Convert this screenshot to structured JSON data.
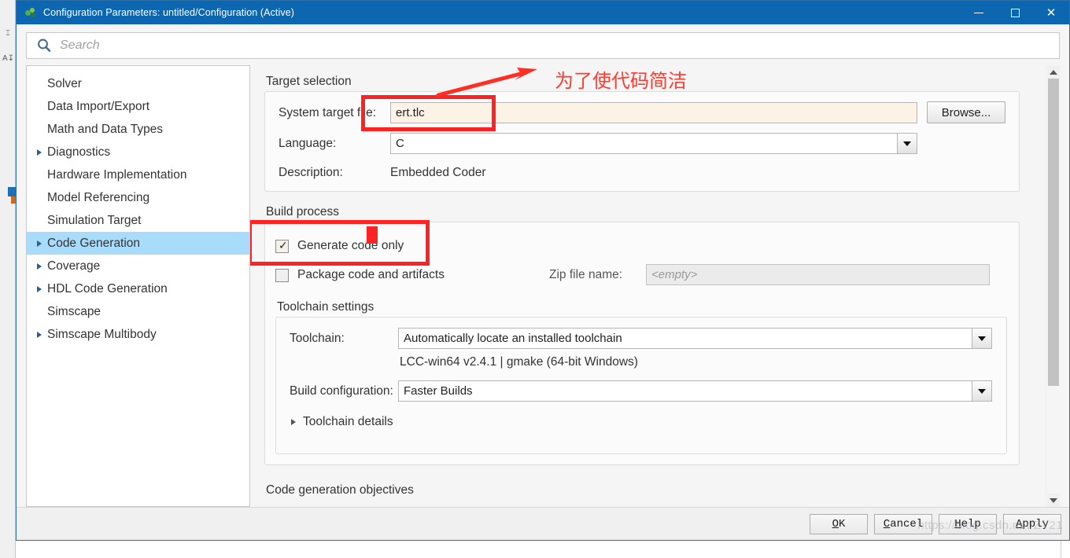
{
  "window": {
    "title": "Configuration Parameters: untitled/Configuration (Active)",
    "icon": "simulink-icon",
    "minimize_label": "—",
    "maximize_label": "□",
    "close_label": "✕"
  },
  "search": {
    "placeholder": "Search",
    "value": "",
    "icon": "search-icon"
  },
  "sidebar": {
    "items": [
      {
        "label": "Solver",
        "expandable": false,
        "selected": false
      },
      {
        "label": "Data Import/Export",
        "expandable": false,
        "selected": false
      },
      {
        "label": "Math and Data Types",
        "expandable": false,
        "selected": false
      },
      {
        "label": "Diagnostics",
        "expandable": true,
        "selected": false
      },
      {
        "label": "Hardware Implementation",
        "expandable": false,
        "selected": false
      },
      {
        "label": "Model Referencing",
        "expandable": false,
        "selected": false
      },
      {
        "label": "Simulation Target",
        "expandable": false,
        "selected": false
      },
      {
        "label": "Code Generation",
        "expandable": true,
        "selected": true
      },
      {
        "label": "Coverage",
        "expandable": true,
        "selected": false
      },
      {
        "label": "HDL Code Generation",
        "expandable": true,
        "selected": false
      },
      {
        "label": "Simscape",
        "expandable": false,
        "selected": false
      },
      {
        "label": "Simscape Multibody",
        "expandable": true,
        "selected": false
      }
    ]
  },
  "target_selection": {
    "title": "Target selection",
    "system_target_file_label": "System target file:",
    "system_target_file_value": "ert.tlc",
    "browse_label": "Browse...",
    "language_label": "Language:",
    "language_value": "C",
    "description_label": "Description:",
    "description_value": "Embedded Coder"
  },
  "build_process": {
    "title": "Build process",
    "generate_code_only_label": "Generate code only",
    "generate_code_only_checked": true,
    "package_code_label": "Package code and artifacts",
    "package_code_checked": false,
    "zip_file_name_label": "Zip file name:",
    "zip_file_name_placeholder": "<empty>",
    "zip_file_name_value": ""
  },
  "toolchain_settings": {
    "title": "Toolchain settings",
    "toolchain_label": "Toolchain:",
    "toolchain_value": "Automatically locate an installed toolchain",
    "toolchain_info": "LCC-win64 v2.4.1 | gmake (64-bit Windows)",
    "build_configuration_label": "Build configuration:",
    "build_configuration_value": "Faster Builds",
    "toolchain_details_label": "Toolchain details"
  },
  "code_generation_objectives": {
    "title": "Code generation objectives"
  },
  "buttons": {
    "ok": {
      "pre": "",
      "mnemonic": "O",
      "post": "K"
    },
    "cancel": {
      "pre": "",
      "mnemonic": "C",
      "post": "ancel"
    },
    "help": {
      "pre": "",
      "mnemonic": "H",
      "post": "elp"
    },
    "apply": {
      "pre": "",
      "mnemonic": "A",
      "post": "pply"
    }
  },
  "annotations": {
    "note_text": "为了使代码简洁",
    "note_color": "#ff3b30",
    "box_color": "#ff2222"
  },
  "watermark": {
    "text": "https://blog.csdn.net/ZY21"
  },
  "colors": {
    "titlebar": "#0d66b0",
    "selection": "#a8dcfa",
    "field_highlight": "#fdf2e6",
    "annotation_red": "#ff2222"
  }
}
